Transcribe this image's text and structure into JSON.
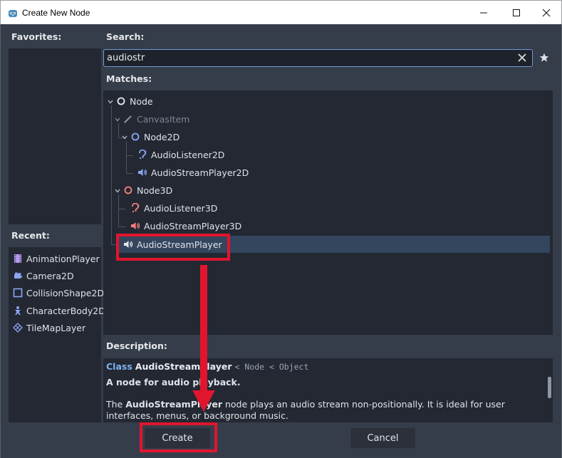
{
  "window": {
    "title": "Create New Node"
  },
  "labels": {
    "favorites": "Favorites:",
    "search": "Search:",
    "matches": "Matches:",
    "recent": "Recent:",
    "description": "Description:"
  },
  "search": {
    "value": "audiostr"
  },
  "tree": [
    {
      "label": "Node",
      "icon": "circle-white-icon",
      "dimmed": false
    },
    {
      "label": "CanvasItem",
      "icon": "pencil-icon",
      "dimmed": true
    },
    {
      "label": "Node2D",
      "icon": "circle-blue-icon",
      "dimmed": false
    },
    {
      "label": "AudioListener2D",
      "icon": "ear-blue-icon",
      "dimmed": false
    },
    {
      "label": "AudioStreamPlayer2D",
      "icon": "speaker-blue-icon",
      "dimmed": false
    },
    {
      "label": "Node3D",
      "icon": "circle-red-icon",
      "dimmed": false
    },
    {
      "label": "AudioListener3D",
      "icon": "ear-red-icon",
      "dimmed": false
    },
    {
      "label": "AudioStreamPlayer3D",
      "icon": "speaker-red-icon",
      "dimmed": false
    },
    {
      "label": "AudioStreamPlayer",
      "icon": "speaker-white-icon",
      "dimmed": false,
      "selected": true
    }
  ],
  "recent": [
    {
      "label": "AnimationPlayer",
      "icon": "film-icon"
    },
    {
      "label": "Camera2D",
      "icon": "camera-icon"
    },
    {
      "label": "CollisionShape2D",
      "icon": "square-outline-icon"
    },
    {
      "label": "CharacterBody2D",
      "icon": "character-icon"
    },
    {
      "label": "TileMapLayer",
      "icon": "tilemap-icon"
    }
  ],
  "description": {
    "class_keyword": "Class",
    "class_name": "AudioStreamPlayer",
    "inheritance": "< Node < Object",
    "brief": "A node for audio playback.",
    "body_pre": "The ",
    "body_class": "AudioStreamPlayer",
    "body_post": " node plays an audio stream non-positionally. It is ideal for user interfaces, menus, or background music."
  },
  "buttons": {
    "create": "Create",
    "cancel": "Cancel"
  },
  "colors": {
    "annotation": "#e1152d",
    "accent": "#6f9bd8",
    "selection": "#34455e"
  }
}
